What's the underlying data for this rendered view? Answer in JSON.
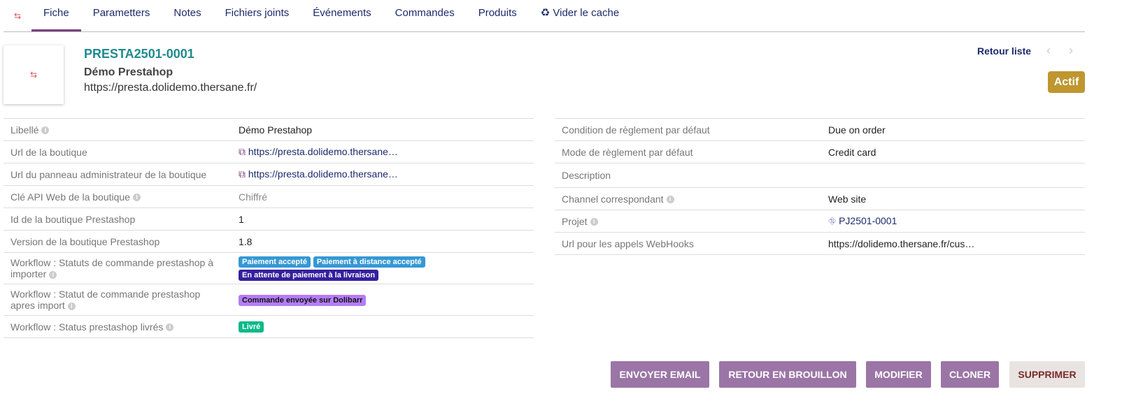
{
  "tabs": [
    "Fiche",
    "Parametters",
    "Notes",
    "Fichiers joints",
    "Événements",
    "Commandes",
    "Produits",
    "Vider le cache"
  ],
  "header": {
    "ref": "PRESTA2501-0001",
    "name": "Démo Prestahop",
    "url": "https://presta.dolidemo.thersane.fr/",
    "back": "Retour liste",
    "status": "Actif"
  },
  "left": [
    {
      "label": "Libellé",
      "value": "Démo Prestahop"
    },
    {
      "label": "Url de la boutique",
      "value": "https://presta.dolidemo.thersane…"
    },
    {
      "label": "Url du panneau administrateur de la boutique",
      "value": "https://presta.dolidemo.thersane…"
    },
    {
      "label": "Clé API Web de la boutique",
      "value": "Chiffré"
    },
    {
      "label": "Id de la boutique Prestashop",
      "value": "1"
    },
    {
      "label": "Version de la boutique Prestashop",
      "value": "1.8"
    },
    {
      "label": "Workflow : Statuts de commande prestashop à importer",
      "badges": [
        "Paiement accepté",
        "Paiement à distance accepté",
        "En attente de paiement à la livraison"
      ]
    },
    {
      "label": "Workflow : Statut de commande prestashop apres import",
      "badges": [
        "Commande envoyée sur Dolibarr"
      ]
    },
    {
      "label": "Workflow : Status prestashop livrés",
      "badges": [
        "Livré"
      ]
    }
  ],
  "right": [
    {
      "label": "Condition de règlement par défaut",
      "value": "Due on order"
    },
    {
      "label": "Mode de règlement par défaut",
      "value": "Credit card"
    },
    {
      "label": "Description",
      "value": ""
    },
    {
      "label": "Channel correspondant",
      "value": "Web site"
    },
    {
      "label": "Projet",
      "value": "PJ2501-0001"
    },
    {
      "label": "Url pour les appels WebHooks",
      "value": "https://dolidemo.thersane.fr/cus…"
    }
  ],
  "buttons": [
    "ENVOYER EMAIL",
    "RETOUR EN BROUILLON",
    "MODIFIER",
    "CLONER",
    "SUPPRIMER"
  ],
  "colors": {
    "accent": "#7b3f7f",
    "status": "#bf962f",
    "button": "#9b75a6"
  }
}
